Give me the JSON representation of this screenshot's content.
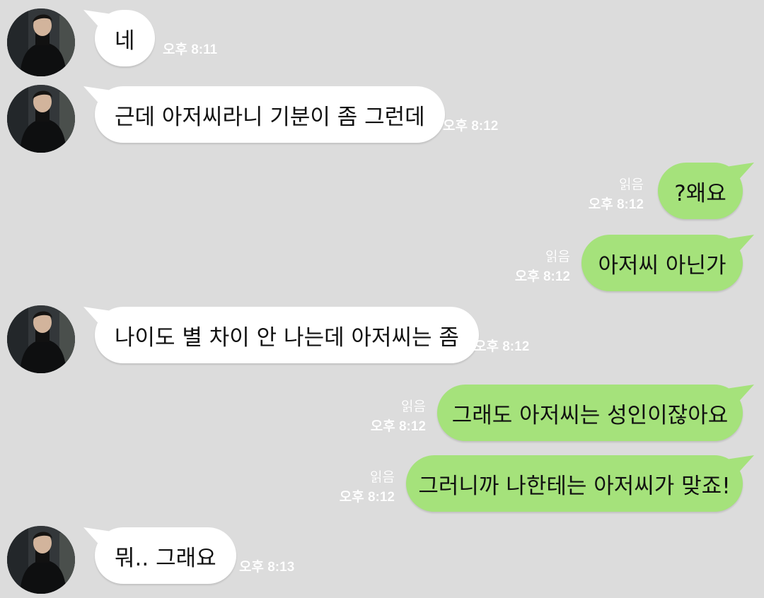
{
  "colors": {
    "background": "#dcdcdc",
    "incoming_bubble": "#ffffff",
    "outgoing_bubble": "#a5e27b",
    "meta_text": "#ffffff"
  },
  "avatar": {
    "icon": "profile-photo-man-black-sweater"
  },
  "messages": [
    {
      "dir": "in",
      "text": "네",
      "time": "오후 8:11"
    },
    {
      "dir": "in",
      "text": "근데 아저씨라니 기분이 좀 그런데",
      "time": "오후 8:12"
    },
    {
      "dir": "out",
      "text": "?왜요",
      "read": "읽음",
      "time": "오후 8:12"
    },
    {
      "dir": "out",
      "text": "아저씨 아닌가",
      "read": "읽음",
      "time": "오후 8:12"
    },
    {
      "dir": "in",
      "text": "나이도 별 차이 안 나는데 아저씨는 좀",
      "time": "오후 8:12"
    },
    {
      "dir": "out",
      "text": "그래도 아저씨는 성인이잖아요",
      "read": "읽음",
      "time": "오후 8:12"
    },
    {
      "dir": "out",
      "text": "그러니까 나한테는 아저씨가 맞죠!",
      "read": "읽음",
      "time": "오후 8:12"
    },
    {
      "dir": "in",
      "text": "뭐.. 그래요",
      "time": "오후 8:13"
    }
  ]
}
